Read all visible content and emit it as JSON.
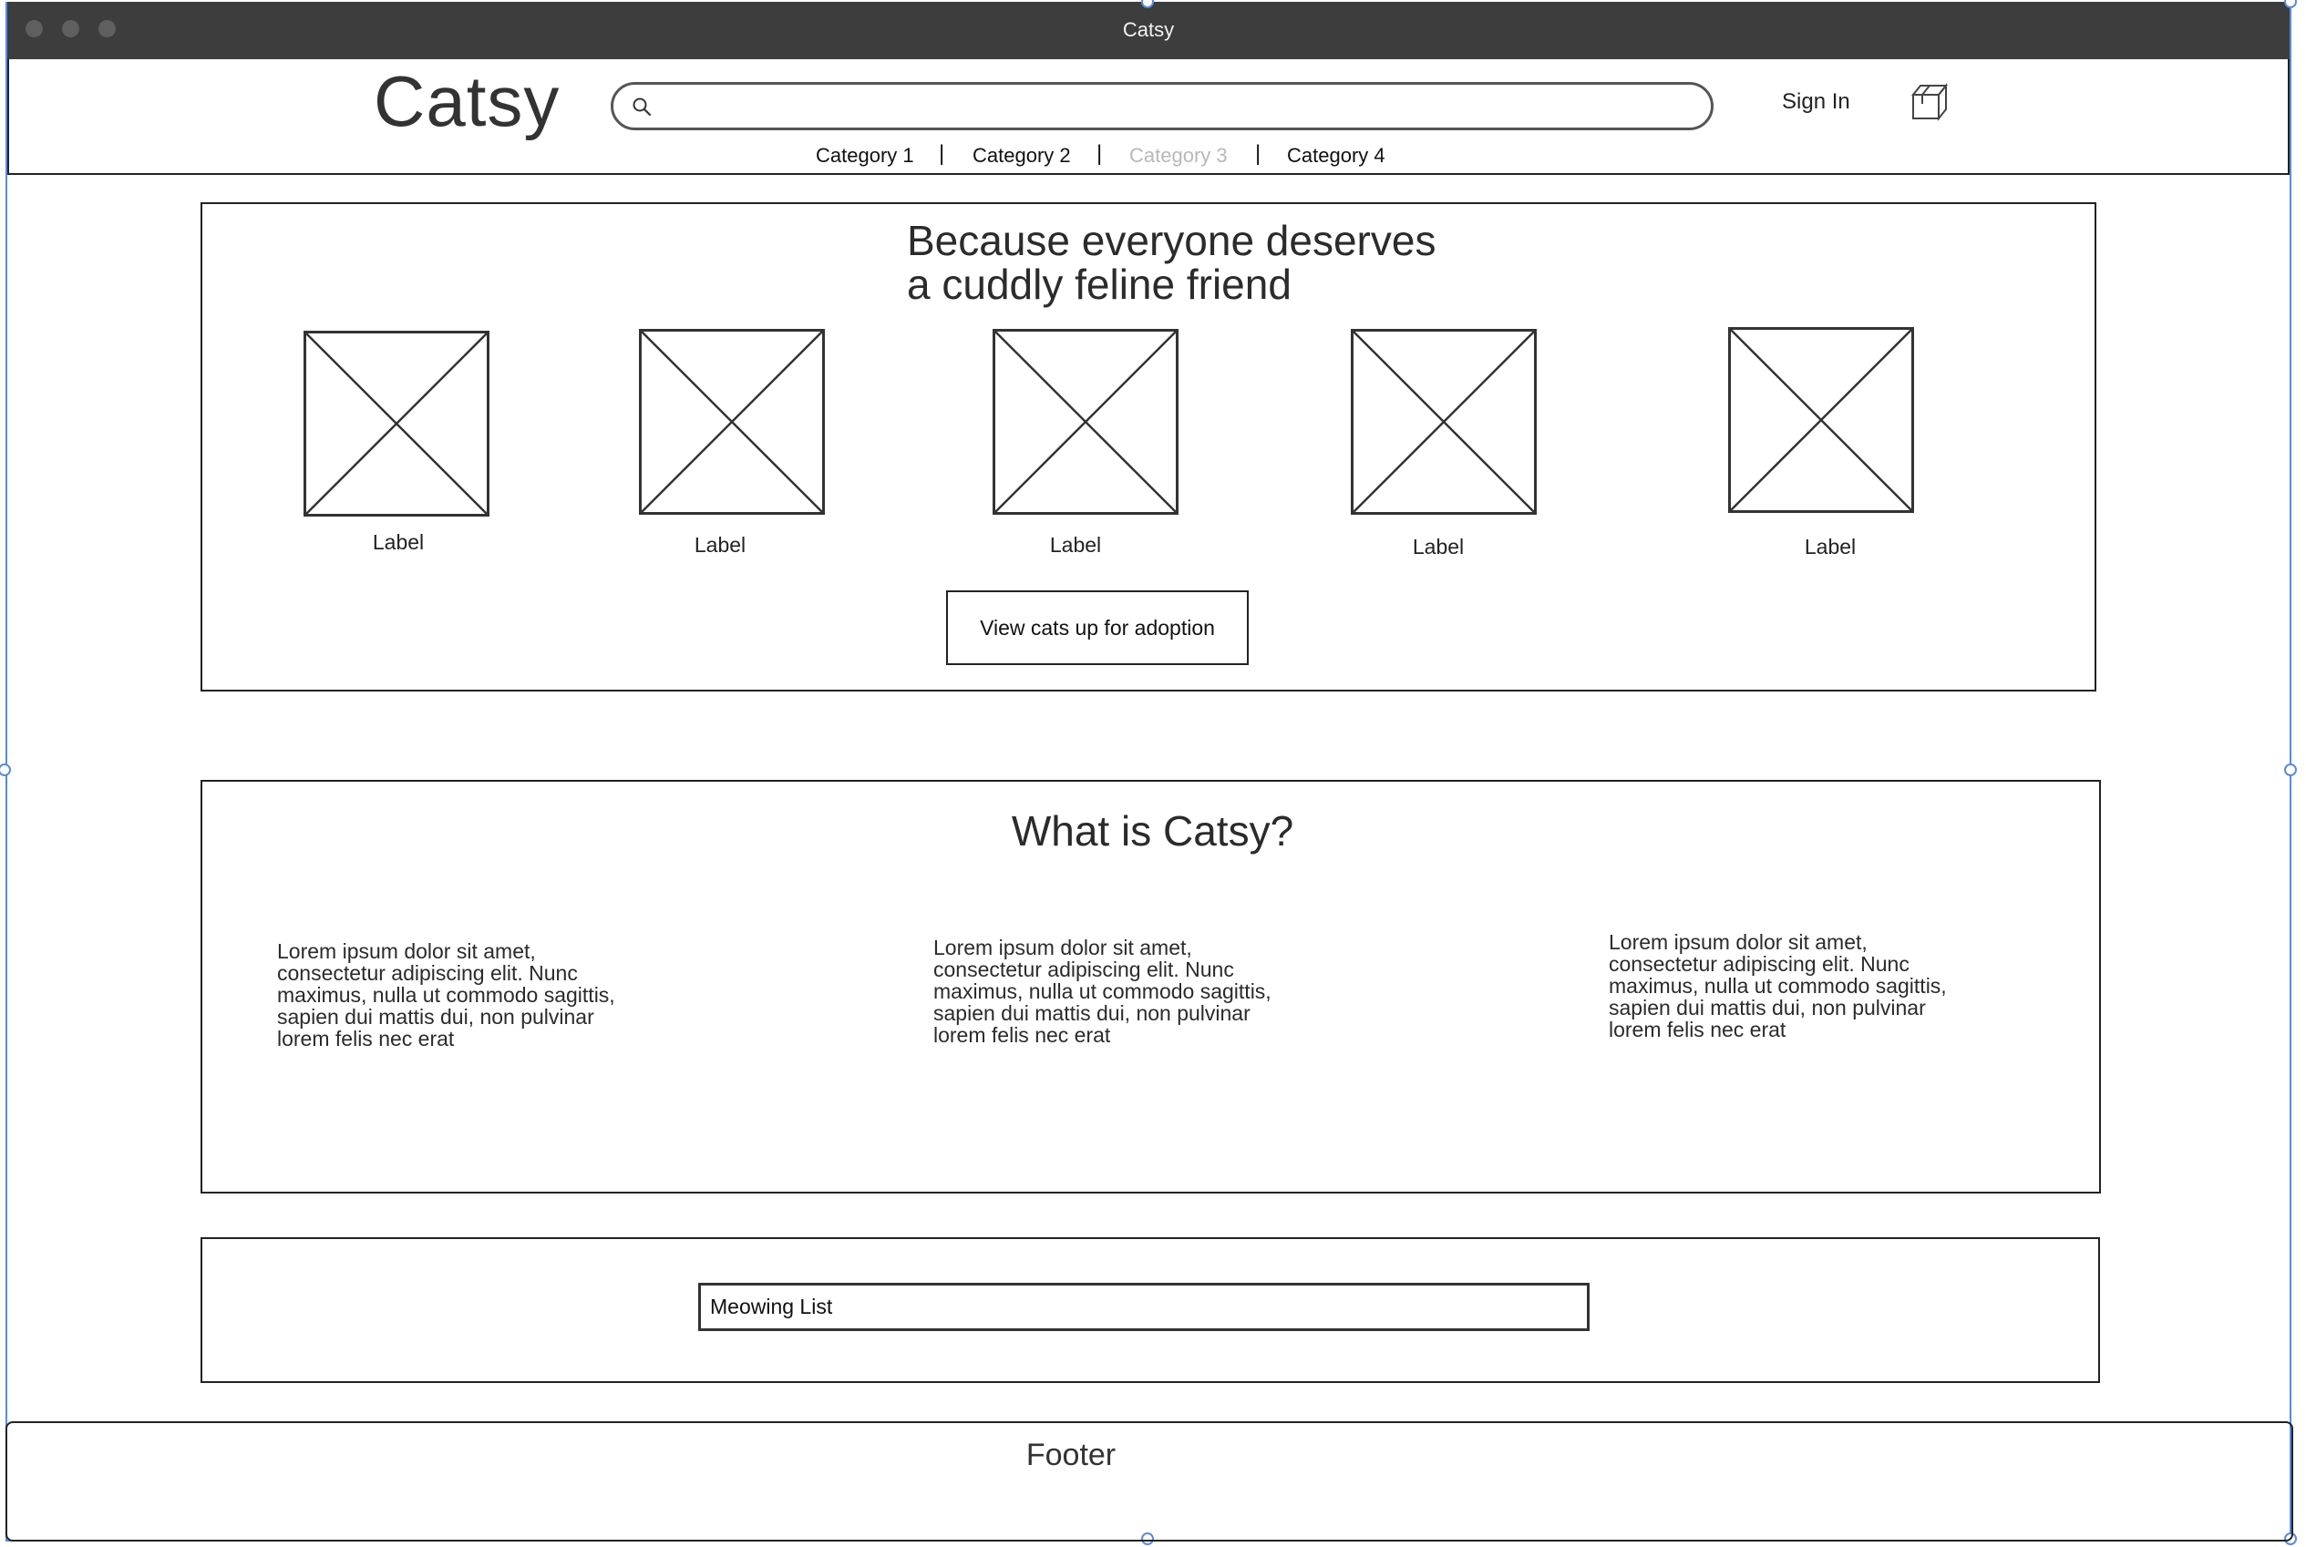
{
  "window": {
    "title": "Catsy"
  },
  "header": {
    "logo": "Catsy",
    "search": {
      "value": "",
      "placeholder": ""
    },
    "sign_in": "Sign In",
    "categories": [
      {
        "label": "Category 1",
        "state": "normal"
      },
      {
        "label": "Category 2",
        "state": "normal"
      },
      {
        "label": "Category 3",
        "state": "disabled"
      },
      {
        "label": "Category 4",
        "state": "normal"
      }
    ],
    "separator": "|"
  },
  "hero": {
    "title_line1": "Because everyone deserves",
    "title_line2": "a cuddly feline friend",
    "items": [
      {
        "label": "Label"
      },
      {
        "label": "Label"
      },
      {
        "label": "Label"
      },
      {
        "label": "Label"
      },
      {
        "label": "Label"
      }
    ],
    "cta_label": "View cats up for adoption"
  },
  "about": {
    "title": "What is Catsy?",
    "columns": [
      {
        "lines": [
          "Lorem ipsum dolor sit amet,",
          "consectetur adipiscing elit. Nunc",
          "maximus, nulla ut commodo sagittis,",
          "sapien dui mattis dui, non pulvinar",
          "lorem felis nec erat"
        ]
      },
      {
        "lines": [
          "Lorem ipsum dolor sit amet,",
          "consectetur adipiscing elit. Nunc",
          "maximus, nulla ut commodo sagittis,",
          "sapien dui mattis dui, non pulvinar",
          "lorem felis nec erat"
        ]
      },
      {
        "lines": [
          "Lorem ipsum dolor sit amet,",
          "consectetur adipiscing elit. Nunc",
          "maximus, nulla ut commodo sagittis,",
          "sapien dui mattis dui, non pulvinar",
          "lorem felis nec erat"
        ]
      }
    ]
  },
  "newsletter": {
    "value": "Meowing List"
  },
  "footer": {
    "label": "Footer"
  },
  "colors": {
    "titlebar": "#3d3d3d",
    "selection": "#5b8bd6",
    "disabled_text": "#b8b8b8",
    "stroke": "#222222"
  },
  "icons": {
    "search": "search-icon",
    "cart": "box-icon"
  }
}
